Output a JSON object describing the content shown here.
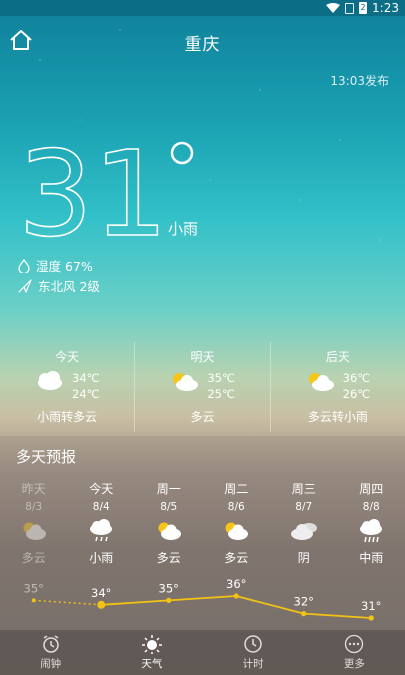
{
  "status": {
    "time": "1:23",
    "battery": "2"
  },
  "header": {
    "city": "重庆",
    "publish_time": "13:03发布"
  },
  "current": {
    "temperature": "31",
    "degree_symbol": "°",
    "condition": "小雨",
    "humidity": "湿度 67%",
    "wind": "东北风 2级"
  },
  "three_days": [
    {
      "name": "今天",
      "high": "34℃",
      "low": "24℃",
      "desc": "小雨转多云",
      "icon": "cloud-rain-sun-icon"
    },
    {
      "name": "明天",
      "high": "35℃",
      "low": "25℃",
      "desc": "多云",
      "icon": "partly-cloudy-icon"
    },
    {
      "name": "后天",
      "high": "36℃",
      "low": "26℃",
      "desc": "多云转小雨",
      "icon": "partly-cloudy-icon"
    }
  ],
  "multi_day": {
    "title": "多天预报",
    "days": [
      {
        "name": "昨天",
        "date": "8/3",
        "cond": "多云",
        "temp": "35°",
        "temp_value": 35,
        "icon": "partly-cloudy-icon",
        "past": true
      },
      {
        "name": "今天",
        "date": "8/4",
        "cond": "小雨",
        "temp": "34°",
        "temp_value": 34,
        "icon": "rain-icon",
        "past": false
      },
      {
        "name": "周一",
        "date": "8/5",
        "cond": "多云",
        "temp": "35°",
        "temp_value": 35,
        "icon": "partly-cloudy-icon",
        "past": false
      },
      {
        "name": "周二",
        "date": "8/6",
        "cond": "多云",
        "temp": "36°",
        "temp_value": 36,
        "icon": "partly-cloudy-icon",
        "past": false
      },
      {
        "name": "周三",
        "date": "8/7",
        "cond": "阴",
        "temp": "32°",
        "temp_value": 32,
        "icon": "overcast-icon",
        "past": false
      },
      {
        "name": "周四",
        "date": "8/8",
        "cond": "中雨",
        "temp": "31°",
        "temp_value": 31,
        "icon": "rain-heavy-icon",
        "past": false
      }
    ]
  },
  "nav": [
    {
      "label": "闹钟",
      "icon": "alarm-clock-icon",
      "active": false
    },
    {
      "label": "天气",
      "icon": "sun-icon",
      "active": true
    },
    {
      "label": "计时",
      "icon": "timer-icon",
      "active": false
    },
    {
      "label": "更多",
      "icon": "more-icon",
      "active": false
    }
  ],
  "colors": {
    "curve": "#f3c313",
    "background_top": "#0f7f9a",
    "background_bottom": "#6f6661"
  }
}
